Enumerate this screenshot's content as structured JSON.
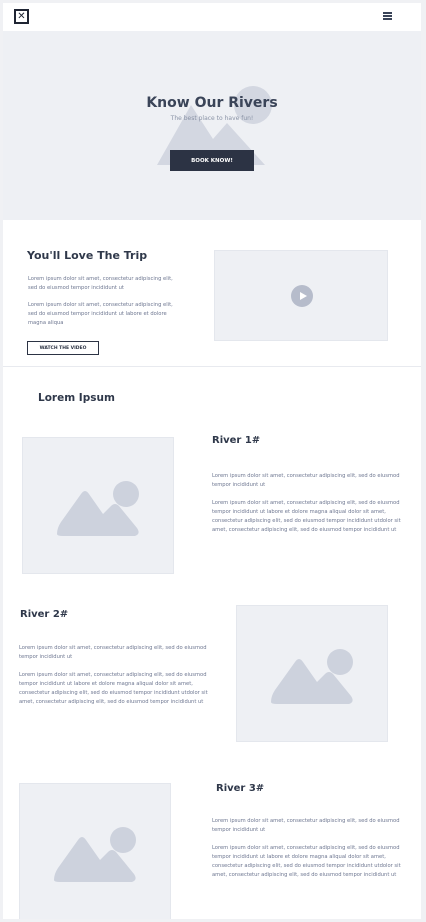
{
  "header": {
    "logo_glyph": "✕",
    "logo_icon": "close-box-icon",
    "menu_icon": "hamburger-menu-icon"
  },
  "hero": {
    "title": "Know Our Rivers",
    "subtitle": "The best place to have fun!",
    "button_label": "BOOK KNOW!"
  },
  "intro": {
    "title": "You'll Love The Trip",
    "paragraph1": "Lorem ipsum dolor sit amet, consectetur adipiscing elit, sed do eiusmod tempor incididunt ut",
    "paragraph2": "Lorem ipsum dolor sit amet, consectetur adipiscing elit, sed do eiusmod tempor incididunt ut labore et dolore magna aliqua",
    "button_label": "WATCH THE VIDEO",
    "video_icon": "play-icon"
  },
  "section": {
    "title": "Lorem Ipsum"
  },
  "rivers": [
    {
      "title": "River 1#",
      "paragraph1": "Lorem ipsum dolor sit amet, consectetur adipiscing elit, sed do eiusmod tempor incididunt ut",
      "paragraph2": "Lorem ipsum dolor sit amet, consectetur adipiscing elit, sed do eiusmod tempor incididunt ut labore et dolore magna aliqual dolor sit amet, consectetur adipiscing elit, sed do eiusmod tempor incididunt utdolor sit amet, consectetur adipiscing elit, sed do eiusmod tempor incididunt ut"
    },
    {
      "title": "River 2#",
      "paragraph1": "Lorem ipsum dolor sit amet, consectetur adipiscing elit, sed do eiusmod tempor incididunt ut",
      "paragraph2": "Lorem ipsum dolor sit amet, consectetur adipiscing elit, sed do eiusmod tempor incididunt ut labore et dolore magna aliqual dolor sit amet, consectetur adipiscing elit, sed do eiusmod tempor incididunt utdolor sit amet, consectetur adipiscing elit, sed do eiusmod tempor incididunt ut"
    },
    {
      "title": "River 3#",
      "paragraph1": "Lorem ipsum dolor sit amet, consectetur adipiscing elit, sed do eiusmod tempor incididunt ut",
      "paragraph2": "Lorem ipsum dolor sit amet, consectetur adipiscing elit, sed do eiusmod tempor incididunt ut labore et dolore magna aliqual dolor sit amet, consectetur adipiscing elit, sed do eiusmod tempor incididunt utdolor sit amet, consectetur adipiscing elit, sed do eiusmod tempor incididunt ut"
    }
  ],
  "colors": {
    "dark": "#2c3344",
    "placeholder_bg": "#eef0f4",
    "placeholder_shape": "#cdd2dd",
    "text_muted": "#6d7690"
  }
}
